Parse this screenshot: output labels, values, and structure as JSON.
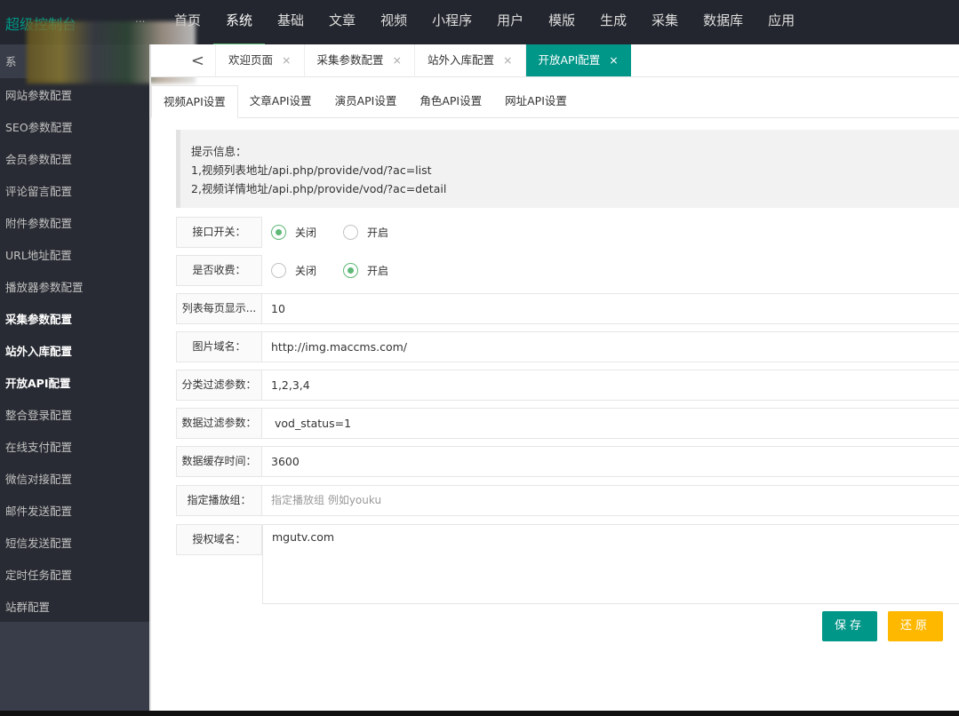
{
  "header": {
    "logo": "超级控制台",
    "more": "...",
    "nav": [
      "首页",
      "系统",
      "基础",
      "文章",
      "视频",
      "小程序",
      "用户",
      "模版",
      "生成",
      "采集",
      "数据库",
      "应用"
    ],
    "active": "系统"
  },
  "sidebar": {
    "items": [
      {
        "label": "系"
      },
      {
        "label": "网站参数配置"
      },
      {
        "label": "SEO参数配置"
      },
      {
        "label": "会员参数配置"
      },
      {
        "label": "评论留言配置"
      },
      {
        "label": "附件参数配置"
      },
      {
        "label": "URL地址配置"
      },
      {
        "label": "播放器参数配置"
      },
      {
        "label": "采集参数配置"
      },
      {
        "label": "站外入库配置"
      },
      {
        "label": "开放API配置"
      },
      {
        "label": "整合登录配置"
      },
      {
        "label": "在线支付配置"
      },
      {
        "label": "微信对接配置"
      },
      {
        "label": "邮件发送配置"
      },
      {
        "label": "短信发送配置"
      },
      {
        "label": "定时任务配置"
      },
      {
        "label": "站群配置"
      }
    ]
  },
  "tabs": {
    "back": "<",
    "close": "×",
    "items": [
      "欢迎页面",
      "采集参数配置",
      "站外入库配置",
      "开放API配置"
    ],
    "active": "开放API配置"
  },
  "subtabs": [
    "视频API设置",
    "文章API设置",
    "演员API设置",
    "角色API设置",
    "网址API设置"
  ],
  "tip": {
    "title": "提示信息：",
    "lines": [
      "1,视频列表地址/api.php/provide/vod/?ac=list",
      "2,视频详情地址/api.php/provide/vod/?ac=detail"
    ]
  },
  "form": {
    "switch": {
      "label": "接口开关：",
      "options": [
        "关闭",
        "开启"
      ],
      "selected": "关闭"
    },
    "charge": {
      "label": "是否收费：",
      "options": [
        "关闭",
        "开启"
      ],
      "selected": "开启"
    },
    "pagesize": {
      "label": "列表每页显示...",
      "value": "10"
    },
    "imgdomain": {
      "label": "图片域名：",
      "value": "http://img.maccms.com/"
    },
    "typefilter": {
      "label": "分类过滤参数：",
      "value": "1,2,3,4"
    },
    "datafilter": {
      "label": "数据过滤参数：",
      "value": " vod_status=1"
    },
    "cachetime": {
      "label": "数据缓存时间：",
      "value": "3600"
    },
    "playfrom": {
      "label": "指定播放组：",
      "placeholder": "指定播放组 例如youku"
    },
    "auth": {
      "label": "授权域名：",
      "value": "mgutv.com"
    }
  },
  "buttons": {
    "save": "保存",
    "reset": "还原"
  },
  "colors": {
    "primary": "#009688",
    "warm": "#FFB800",
    "radio": "#5fb878"
  }
}
